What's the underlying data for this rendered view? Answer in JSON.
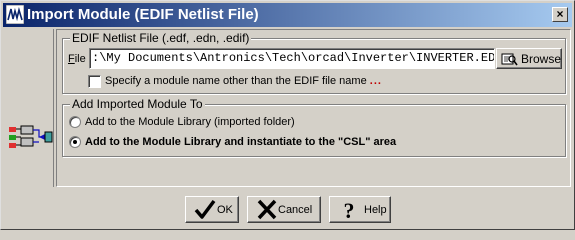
{
  "window": {
    "title": "Import Module (EDIF Netlist File)",
    "close_glyph": "×",
    "icon": "wave-app-icon"
  },
  "edif_group": {
    "legend": "EDIF Netlist File (.edf, .edn, .edif)",
    "file_label": "File",
    "file_value": ":\\My Documents\\Antronics\\Tech\\orcad\\Inverter\\INVERTER.EDN",
    "browse_label": "Browse",
    "browse_icon": "browse-folder-icon",
    "specify_checkbox_checked": false,
    "specify_label": "Specify a module name other than the EDIF file name",
    "specify_dots": "..."
  },
  "add_group": {
    "legend": "Add Imported Module To",
    "options": [
      {
        "label": "Add to the Module Library (imported folder)",
        "selected": false
      },
      {
        "label": "Add to the Module Library and instantiate to the \"CSL\" area",
        "selected": true
      }
    ]
  },
  "buttons": {
    "ok": "OK",
    "cancel": "Cancel",
    "help": "Help"
  },
  "colors": {
    "title_gradient_start": "#0a246a",
    "title_gradient_end": "#a6caf0",
    "dialog_face": "#d4d0c8",
    "dots_red": "#c00000"
  }
}
